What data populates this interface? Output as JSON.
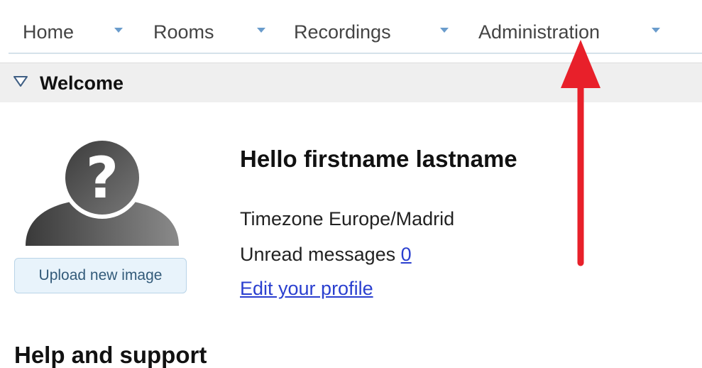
{
  "menu": {
    "items": [
      {
        "label": "Home"
      },
      {
        "label": "Rooms"
      },
      {
        "label": "Recordings"
      },
      {
        "label": "Administration"
      }
    ]
  },
  "welcome": {
    "title": "Welcome",
    "greeting": "Hello firstname lastname",
    "timezone_text": "Timezone Europe/Madrid",
    "unread_label": "Unread messages",
    "unread_count": "0",
    "edit_profile_link": "Edit your profile",
    "upload_button": "Upload new image"
  },
  "help": {
    "title": "Help and support"
  },
  "colors": {
    "menu_arrow": "#6a9ccc",
    "annotation": "#e8202a",
    "link": "#2a3fcf"
  }
}
